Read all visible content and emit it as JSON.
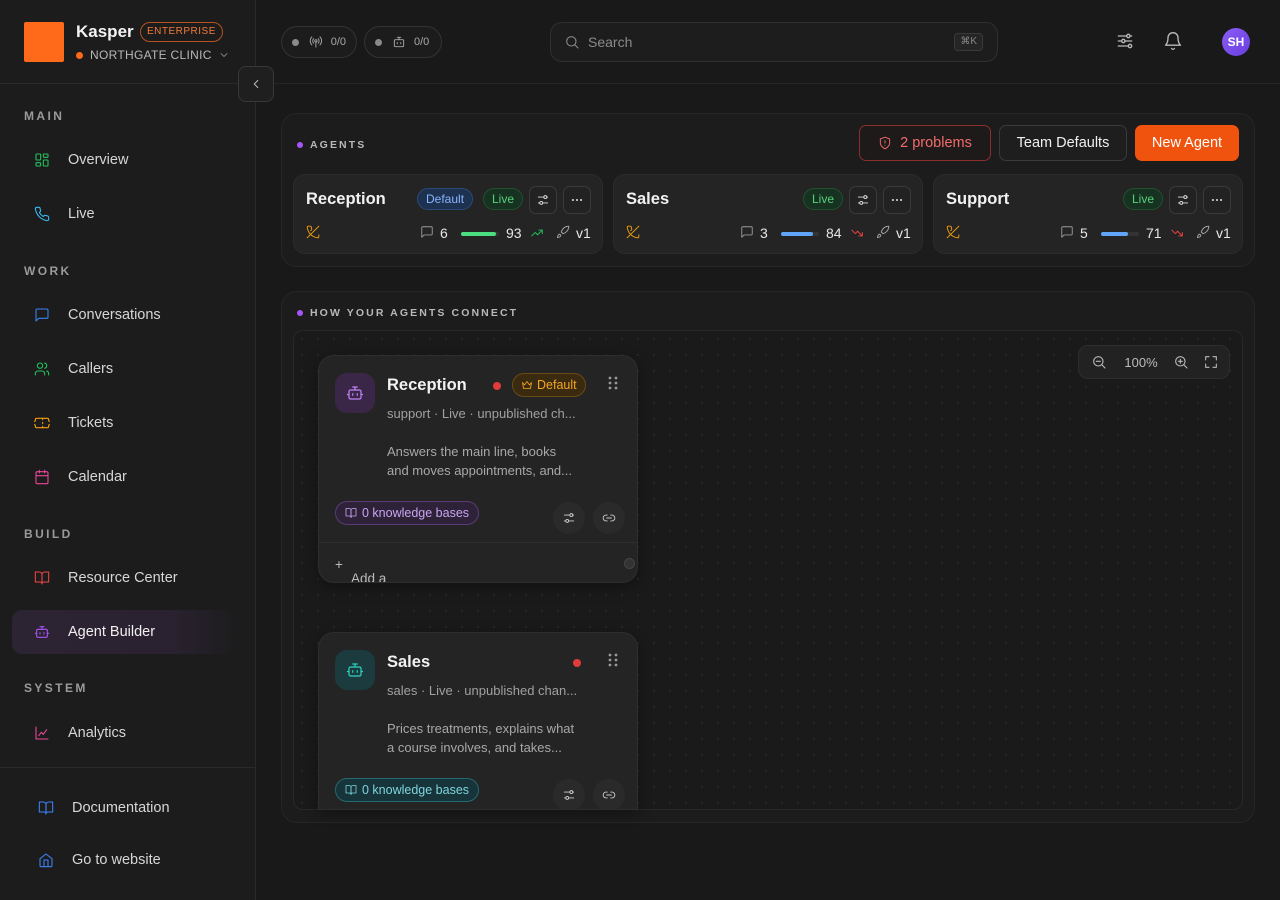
{
  "brand": {
    "name": "Kasper",
    "badge": "ENTERPRISE",
    "org": "NORTHGATE CLINIC",
    "accent": "#ff6a1a"
  },
  "sidebar": {
    "sections": [
      {
        "label": "MAIN",
        "items": [
          {
            "label": "Overview",
            "icon": "grid-icon"
          },
          {
            "label": "Live",
            "icon": "phone-icon"
          }
        ]
      },
      {
        "label": "WORK",
        "items": [
          {
            "label": "Conversations",
            "icon": "chat-icon"
          },
          {
            "label": "Callers",
            "icon": "users-icon"
          },
          {
            "label": "Tickets",
            "icon": "ticket-icon"
          },
          {
            "label": "Calendar",
            "icon": "calendar-icon"
          }
        ]
      },
      {
        "label": "BUILD",
        "items": [
          {
            "label": "Resource Center",
            "icon": "book-icon"
          },
          {
            "label": "Agent Builder",
            "icon": "bot-icon",
            "active": true
          }
        ]
      },
      {
        "label": "SYSTEM",
        "items": [
          {
            "label": "Analytics",
            "icon": "chart-icon"
          }
        ]
      }
    ],
    "footer": [
      {
        "label": "Documentation",
        "icon": "book-icon"
      },
      {
        "label": "Go to website",
        "icon": "home-icon"
      }
    ]
  },
  "topbar": {
    "status_pills": [
      {
        "icon": "antenna-icon",
        "value": "0/0"
      },
      {
        "icon": "bot-icon",
        "value": "0/0"
      }
    ],
    "search": {
      "placeholder": "Search",
      "shortcut": "⌘K"
    },
    "avatar_initials": "SH"
  },
  "agents_panel": {
    "label": "AGENTS",
    "problems_label": "2 problems",
    "team_defaults_label": "Team Defaults",
    "new_agent_label": "New Agent",
    "cards": [
      {
        "name": "Reception",
        "default_tag": "Default",
        "live_tag": "Live",
        "conversations": "6",
        "score": "93",
        "score_fraction": 0.93,
        "trend": "up",
        "version": "v1"
      },
      {
        "name": "Sales",
        "live_tag": "Live",
        "conversations": "3",
        "score": "84",
        "score_fraction": 0.84,
        "trend": "down",
        "version": "v1"
      },
      {
        "name": "Support",
        "live_tag": "Live",
        "conversations": "5",
        "score": "71",
        "score_fraction": 0.71,
        "trend": "down",
        "version": "v1"
      }
    ]
  },
  "connect_panel": {
    "label": "HOW YOUR AGENTS CONNECT",
    "zoom": "100%",
    "nodes": [
      {
        "name": "Reception",
        "default_tag": "Default",
        "subtitle": "support · Live · unpublished ch...",
        "description_line1": "Answers the main line, books",
        "description_line2": "and moves appointments, and...",
        "knowledge": "0 knowledge bases",
        "add_route": "Add a route from Reception"
      },
      {
        "name": "Sales",
        "subtitle": "sales · Live · unpublished chan...",
        "description_line1": "Prices treatments, explains what",
        "description_line2": "a course involves, and takes...",
        "knowledge": "0 knowledge bases"
      }
    ]
  }
}
